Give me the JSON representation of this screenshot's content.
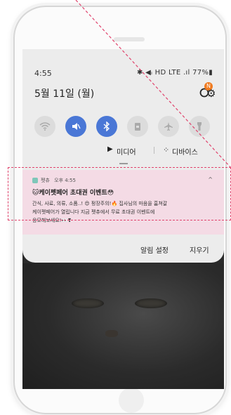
{
  "status_bar": {
    "time": "4:55",
    "icons_text": "✱ ◀ᵢ HD LTE .ıl 77%▮"
  },
  "quick_panel": {
    "date": "5월 11일 (월)",
    "badge": "N",
    "toggles": [
      {
        "name": "wifi",
        "state": "off"
      },
      {
        "name": "sound-mute",
        "state": "on"
      },
      {
        "name": "bluetooth",
        "state": "on"
      },
      {
        "name": "screen-lock",
        "state": "off"
      },
      {
        "name": "airplane",
        "state": "off"
      },
      {
        "name": "flashlight",
        "state": "off"
      }
    ],
    "media_label": "미디어",
    "devices_label": "디바이스"
  },
  "notification": {
    "app": "펫츄",
    "time": "오후 4:55",
    "title": "🐱케이펫페어 초대권 이벤트😳",
    "body_line1": "간식, 사료, 의류, 소품..! 😍 펑장주의!🔥 집사님의 마음을 훔쳐갈",
    "body_line2": "케이펫페어가 열립니다 지금 펫츄에서 무료 초대권 이벤트에",
    "body_line3": "응모해보세요!👀❣"
  },
  "actions": {
    "settings_label": "알림 설정",
    "clear_label": "지우기"
  },
  "colors": {
    "accent": "#4a77d6",
    "highlight_border": "#e0436c",
    "highlight_fill": "#f4dbe5"
  }
}
